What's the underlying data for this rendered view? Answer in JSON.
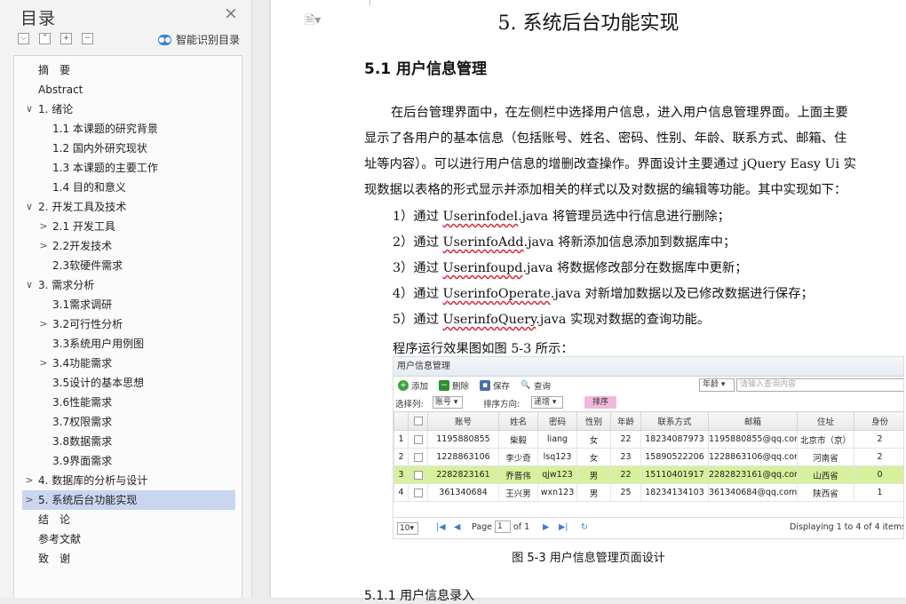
{
  "toc": {
    "title": "目录",
    "close_icon": "×",
    "tools": [
      "⌵",
      "⌃",
      "+",
      "−"
    ],
    "smart_label": "智能识别目录",
    "items": [
      {
        "label": "摘　要",
        "level": 0,
        "chev": ""
      },
      {
        "label": "Abstract",
        "level": 0,
        "chev": ""
      },
      {
        "label": "1. 绪论",
        "level": 0,
        "chev": "∨"
      },
      {
        "label": "1.1  本课题的研究背景",
        "level": 1,
        "chev": ""
      },
      {
        "label": "1.2  国内外研究现状",
        "level": 1,
        "chev": ""
      },
      {
        "label": "1.3  本课题的主要工作",
        "level": 1,
        "chev": ""
      },
      {
        "label": "1.4  目的和意义",
        "level": 1,
        "chev": ""
      },
      {
        "label": "2. 开发工具及技术",
        "level": 0,
        "chev": "∨"
      },
      {
        "label": "2.1 开发工具",
        "level": 1,
        "chev": ">"
      },
      {
        "label": "2.2开发技术",
        "level": 1,
        "chev": ">"
      },
      {
        "label": "2.3软硬件需求",
        "level": 1,
        "chev": ""
      },
      {
        "label": "3. 需求分析",
        "level": 0,
        "chev": "∨"
      },
      {
        "label": "3.1需求调研",
        "level": 1,
        "chev": ""
      },
      {
        "label": "3.2可行性分析",
        "level": 1,
        "chev": ">"
      },
      {
        "label": "3.3系统用户用例图",
        "level": 1,
        "chev": ""
      },
      {
        "label": "3.4功能需求",
        "level": 1,
        "chev": ">"
      },
      {
        "label": "3.5设计的基本思想",
        "level": 1,
        "chev": ""
      },
      {
        "label": "3.6性能需求",
        "level": 1,
        "chev": ""
      },
      {
        "label": "3.7权限需求",
        "level": 1,
        "chev": ""
      },
      {
        "label": "3.8数据需求",
        "level": 1,
        "chev": ""
      },
      {
        "label": "3.9界面需求",
        "level": 1,
        "chev": ""
      },
      {
        "label": "4. 数据库的分析与设计",
        "level": 0,
        "chev": ">"
      },
      {
        "label": "5. 系统后台功能实现",
        "level": 0,
        "chev": ">",
        "selected": true
      },
      {
        "label": "结　论",
        "level": 0,
        "chev": ""
      },
      {
        "label": "参考文献",
        "level": 0,
        "chev": ""
      },
      {
        "label": "致　谢",
        "level": 0,
        "chev": ""
      }
    ]
  },
  "doc": {
    "chapter_title": "5. 系统后台功能实现",
    "section_title": "5.1 用户信息管理",
    "para_lines": [
      "在后台管理界面中，在左侧栏中选择用户信息，进入用户信息管理界面。上面主要",
      "显示了各用户的基本信息（包括账号、姓名、密码、性别、年龄、联系方式、邮箱、住",
      "址等内容）。可以进行用户信息的增删改查操作。界面设计主要通过 jQuery Easy Ui 实",
      "现数据以表格的形式显示并添加相关的样式以及对数据的编辑等功能。其中实现如下："
    ],
    "list": [
      {
        "pre": "1）通过 ",
        "cls": "Userinfodel",
        "post": ".java 将管理员选中行信息进行删除；"
      },
      {
        "pre": "2）通过 ",
        "cls": "UserinfoAdd",
        "post": ".java 将新添加信息添加到数据库中；"
      },
      {
        "pre": "3）通过 ",
        "cls": "Userinfoupd",
        "post": ".java 将数据修改部分在数据库中更新；"
      },
      {
        "pre": "4）通过 ",
        "cls": "UserinfoOperate",
        "post": ".java 对新增加数据以及已修改数据进行保存；"
      },
      {
        "pre": "5）通过 ",
        "cls": "UserinfoQuery",
        "post": ".java 实现对数据的查询功能。"
      }
    ],
    "run_intro": "程序运行效果图如图 5-3 所示：",
    "figure_caption": "图 5-3  用户信息管理页面设计",
    "cut_line": "5.1.1 用户信息录入"
  },
  "figure": {
    "title": "用户信息管理",
    "toolbar": {
      "add": "添加",
      "delete": "删除",
      "save": "保存",
      "query": "查询"
    },
    "age_select": "年龄",
    "search_placeholder": "请输入查询内容",
    "sort_col_label": "选择列:",
    "sort_col_value": "账号",
    "sort_dir_label": "排序方向:",
    "sort_dir_value": "递增",
    "sort_button": "排序",
    "columns": [
      "",
      "",
      "账号",
      "姓名",
      "密码",
      "性别",
      "年龄",
      "联系方式",
      "邮箱",
      "住址",
      "身份"
    ],
    "rows": [
      [
        "1",
        "1195880855",
        "柴毅",
        "liang",
        "女",
        "22",
        "18234087973",
        "1195880855@qq.com",
        "北京市（京）",
        "2"
      ],
      [
        "2",
        "1228863106",
        "李少奇",
        "lsq123",
        "女",
        "23",
        "15890522206",
        "1228863106@qq.com",
        "河南省",
        "2"
      ],
      [
        "3",
        "2282823161",
        "乔晋伟",
        "qjw123",
        "男",
        "22",
        "15110401917",
        "2282823161@qq.com",
        "山西省",
        "0"
      ],
      [
        "4",
        "361340684",
        "王兴男",
        "wxn123",
        "男",
        "25",
        "18234134103",
        "361340684@qq.com",
        "陕西省",
        "1"
      ]
    ],
    "highlight_row": 2,
    "pager": {
      "page_size": "10",
      "page_label": "Page",
      "page_value": "1",
      "of_label": "of 1",
      "display": "Displaying 1 to 4 of 4 items"
    },
    "colors": {
      "highlight": "#d7f09b",
      "sort_btn": "#f2b8d9",
      "toc_selected": "#c9d6ee"
    }
  }
}
